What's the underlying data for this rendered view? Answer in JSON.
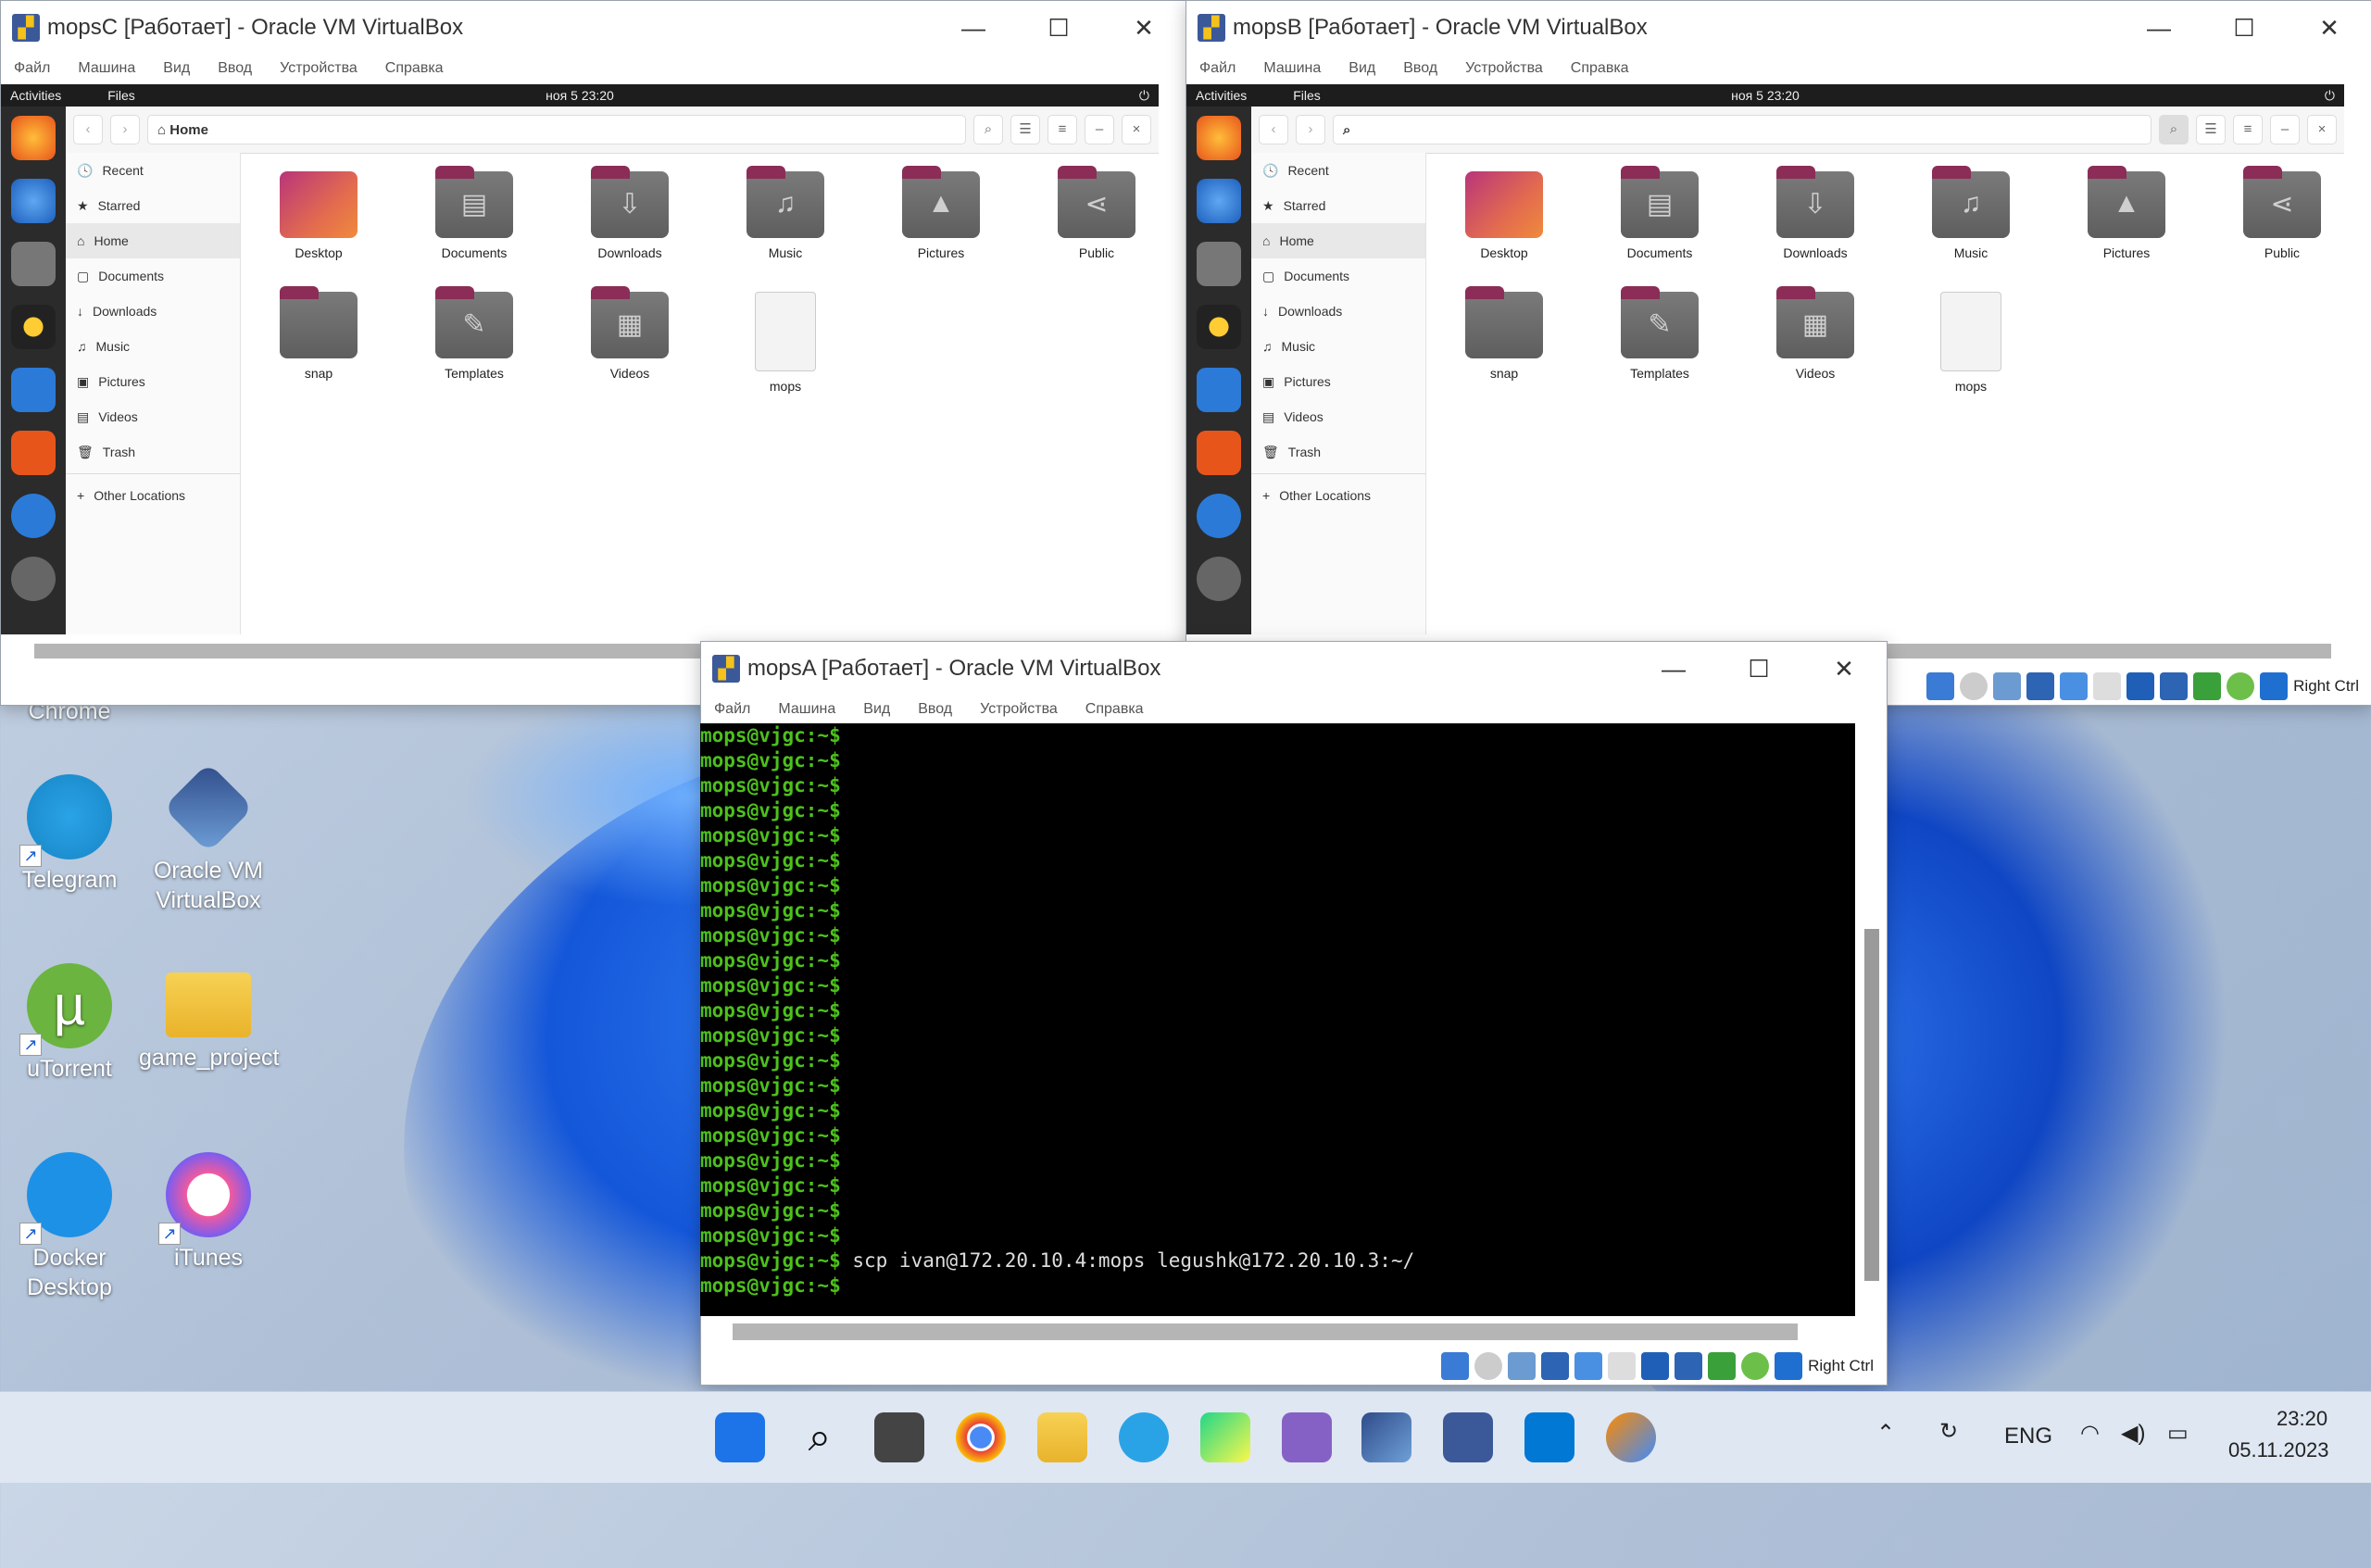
{
  "desktop": {
    "icons": [
      {
        "label": "Chrome",
        "icon": "chrome-icon"
      },
      {
        "label": "Telegram",
        "icon": "telegram-icon"
      },
      {
        "label": "Oracle VM VirtualBox",
        "icon": "virtualbox-icon"
      },
      {
        "label": "uTorrent",
        "icon": "utorrent-icon"
      },
      {
        "label": "game_project",
        "icon": "folder-icon"
      },
      {
        "label": "Docker Desktop",
        "icon": "docker-icon"
      },
      {
        "label": "iTunes",
        "icon": "itunes-icon"
      }
    ]
  },
  "vm_menu": [
    "Файл",
    "Машина",
    "Вид",
    "Ввод",
    "Устройства",
    "Справка"
  ],
  "windows": {
    "mopsC": {
      "title": "mopsC [Работает] - Oracle VM VirtualBox",
      "clock": "ноя 5  23:20",
      "path": "Home"
    },
    "mopsB": {
      "title": "mopsB [Работает] - Oracle VM VirtualBox",
      "clock": "ноя 5  23:20",
      "path": ""
    },
    "mopsA": {
      "title": "mopsA [Работает] - Oracle VM VirtualBox"
    }
  },
  "ubuntu": {
    "activities": "Activities",
    "app": "Files",
    "sidebar": [
      "Recent",
      "Starred",
      "Home",
      "Documents",
      "Downloads",
      "Music",
      "Pictures",
      "Videos",
      "Trash"
    ],
    "other_locations": "Other Locations",
    "files": [
      "Desktop",
      "Documents",
      "Downloads",
      "Music",
      "Pictures",
      "Public",
      "snap",
      "Templates",
      "Videos",
      "mops"
    ]
  },
  "host_key": "Right Ctrl",
  "terminal": {
    "prompt": "mops@vjgc:~$",
    "command": "scp ivan@172.20.10.4:mops legushk@172.20.10.3:~/",
    "empty_prompt_lines": 21
  },
  "taskbar": {
    "apps": [
      "start-icon",
      "search-icon",
      "task-view-icon",
      "chrome-icon",
      "explorer-icon",
      "telegram-icon",
      "pycharm-icon",
      "visual-studio-icon",
      "virtualbox-icon",
      "vmware-icon",
      "vscode-icon",
      "paint-icon"
    ],
    "language": "ENG",
    "time": "23:20",
    "date": "05.11.2023"
  }
}
